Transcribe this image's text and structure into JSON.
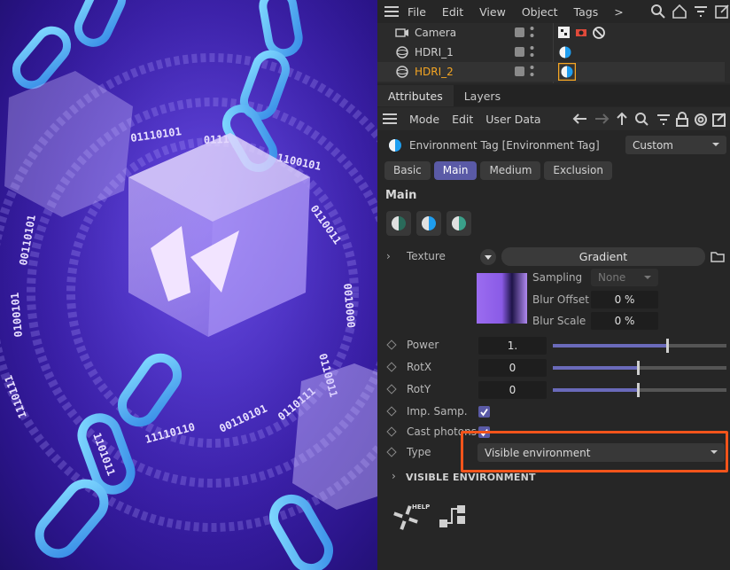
{
  "menubar": {
    "items": [
      "File",
      "Edit",
      "View",
      "Object",
      "Tags"
    ],
    "more": ">"
  },
  "objects": [
    {
      "name": "Camera",
      "selected": false
    },
    {
      "name": "HDRI_1",
      "selected": false
    },
    {
      "name": "HDRI_2",
      "selected": true
    }
  ],
  "panel_tabs": [
    "Attributes",
    "Layers"
  ],
  "attr_menu": [
    "Mode",
    "Edit",
    "User Data"
  ],
  "object_header": {
    "title": "Environment Tag [Environment Tag]",
    "preset": "Custom"
  },
  "subtabs": [
    {
      "label": "Basic",
      "active": false
    },
    {
      "label": "Main",
      "active": true
    },
    {
      "label": "Medium",
      "active": false
    },
    {
      "label": "Exclusion",
      "active": false
    }
  ],
  "section": "Main",
  "texture": {
    "label": "Texture",
    "value": "Gradient",
    "sampling_label": "Sampling",
    "sampling_value": "None",
    "blur_offset_label": "Blur Offset",
    "blur_offset_value": "0 %",
    "blur_scale_label": "Blur Scale",
    "blur_scale_value": "0 %"
  },
  "params": {
    "power": {
      "label": "Power",
      "value": "1.",
      "fraction": 0.66
    },
    "rotx": {
      "label": "RotX",
      "value": "0",
      "fraction": 0.49
    },
    "roty": {
      "label": "RotY",
      "value": "0",
      "fraction": 0.49
    },
    "imp_samp": {
      "label": "Imp. Samp.",
      "checked": true
    },
    "cast_photons": {
      "label": "Cast photons",
      "checked": true
    },
    "type": {
      "label": "Type",
      "value": "Visible environment"
    }
  },
  "group": "VISIBLE ENVIRONMENT",
  "help_label": "HELP",
  "viewport": {
    "binary_strings": [
      "01110101",
      "01110",
      "01100101",
      "0110011",
      "0010000",
      "00110101",
      "0100101",
      "1110111",
      "11110110",
      "00110101",
      "0110111",
      "1101011",
      "0110011"
    ]
  },
  "colors": {
    "accent": "#5a5aa6",
    "selected_text": "#f5a623",
    "highlight": "#f2541b"
  }
}
